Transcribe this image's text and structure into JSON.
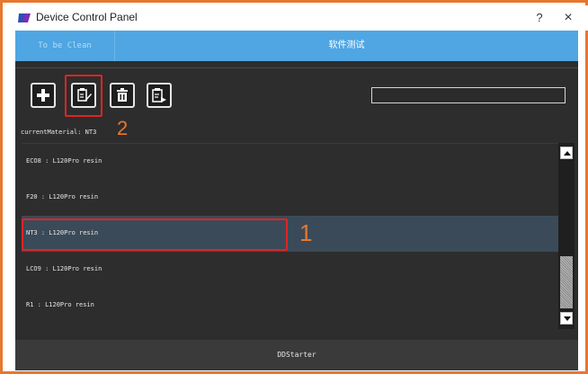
{
  "window": {
    "title": "Device Control Panel",
    "help_label": "?",
    "close_label": "×"
  },
  "tabs": [
    {
      "label": "To be Clean"
    },
    {
      "label": "软件测试"
    }
  ],
  "toolbar": {
    "add": "add-icon",
    "edit": "edit-icon",
    "delete": "delete-icon",
    "export": "export-icon"
  },
  "search": {
    "value": ""
  },
  "current_material": "currentMaterial: NT3",
  "callouts": {
    "edit": "2",
    "selected_row": "1"
  },
  "materials": [
    {
      "label": "ECO8 : L120Pro resin"
    },
    {
      "label": "F20 : L120Pro resin"
    },
    {
      "label": "NT3 : L120Pro resin"
    },
    {
      "label": "LCO9 : L120Pro resin"
    },
    {
      "label": "R1 : L120Pro resin"
    }
  ],
  "status": "DDStarter",
  "colors": {
    "frame": "#e8772e",
    "tab_bar": "#4fa6e2",
    "workspace": "#2d2d2d",
    "selected_row": "#3b4a58",
    "highlight": "#e02424"
  }
}
